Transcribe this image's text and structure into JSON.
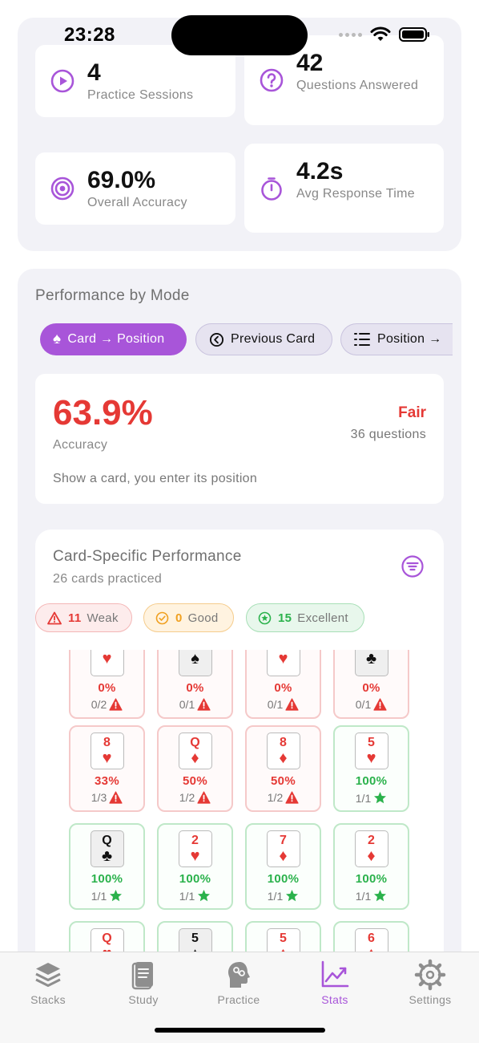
{
  "status_bar": {
    "time": "23:28"
  },
  "stats": [
    {
      "value": "4",
      "label": "Practice Sessions",
      "icon": "play-circle-icon"
    },
    {
      "value": "42",
      "label": "Questions Answered",
      "icon": "question-circle-icon"
    },
    {
      "value": "69.0%",
      "label": "Overall Accuracy",
      "icon": "target-icon"
    },
    {
      "value": "4.2s",
      "label": "Avg Response Time",
      "icon": "stopwatch-icon"
    }
  ],
  "performance": {
    "title": "Performance by Mode",
    "modes": [
      {
        "label": "Card → Position",
        "icon": "spade-icon",
        "active": true
      },
      {
        "label": "Previous Card",
        "icon": "back-circle-icon",
        "active": false
      },
      {
        "label": "Position →",
        "icon": "list-icon",
        "active": false
      }
    ],
    "accuracy": {
      "value": "63.9%",
      "label": "Accuracy",
      "rating": "Fair",
      "questions": "36 questions",
      "description": "Show a card, you enter its position"
    }
  },
  "card_specific": {
    "title": "Card-Specific Performance",
    "subtitle": "26 cards practiced",
    "badges": {
      "weak": {
        "count": "11",
        "label": "Weak"
      },
      "good": {
        "count": "0",
        "label": "Good"
      },
      "excellent": {
        "count": "15",
        "label": "Excellent"
      }
    },
    "cards": [
      {
        "rank": "",
        "suit": "♥",
        "color": "red",
        "pct": "0%",
        "frac": "0/2",
        "status": "weak"
      },
      {
        "rank": "",
        "suit": "♠",
        "color": "black",
        "pct": "0%",
        "frac": "0/1",
        "status": "weak"
      },
      {
        "rank": "",
        "suit": "♥",
        "color": "red",
        "pct": "0%",
        "frac": "0/1",
        "status": "weak"
      },
      {
        "rank": "",
        "suit": "♣",
        "color": "black",
        "pct": "0%",
        "frac": "0/1",
        "status": "weak"
      },
      {
        "rank": "8",
        "suit": "♥",
        "color": "red",
        "pct": "33%",
        "frac": "1/3",
        "status": "weak"
      },
      {
        "rank": "Q",
        "suit": "♦",
        "color": "red",
        "pct": "50%",
        "frac": "1/2",
        "status": "weak"
      },
      {
        "rank": "8",
        "suit": "♦",
        "color": "red",
        "pct": "50%",
        "frac": "1/2",
        "status": "weak"
      },
      {
        "rank": "5",
        "suit": "♥",
        "color": "red",
        "pct": "100%",
        "frac": "1/1",
        "status": "excellent"
      },
      {
        "rank": "Q",
        "suit": "♣",
        "color": "black",
        "pct": "100%",
        "frac": "1/1",
        "status": "excellent"
      },
      {
        "rank": "2",
        "suit": "♥",
        "color": "red",
        "pct": "100%",
        "frac": "1/1",
        "status": "excellent"
      },
      {
        "rank": "7",
        "suit": "♦",
        "color": "red",
        "pct": "100%",
        "frac": "1/1",
        "status": "excellent"
      },
      {
        "rank": "2",
        "suit": "♦",
        "color": "red",
        "pct": "100%",
        "frac": "1/1",
        "status": "excellent"
      },
      {
        "rank": "Q",
        "suit": "♥",
        "color": "red",
        "pct": "",
        "frac": "",
        "status": "excellent"
      },
      {
        "rank": "5",
        "suit": "♠",
        "color": "black",
        "pct": "",
        "frac": "",
        "status": "excellent"
      },
      {
        "rank": "5",
        "suit": "♦",
        "color": "red",
        "pct": "",
        "frac": "",
        "status": "excellent"
      },
      {
        "rank": "6",
        "suit": "♦",
        "color": "red",
        "pct": "",
        "frac": "",
        "status": "excellent"
      }
    ]
  },
  "tabs": [
    {
      "label": "Stacks",
      "icon": "stacks-icon",
      "active": false
    },
    {
      "label": "Study",
      "icon": "book-icon",
      "active": false
    },
    {
      "label": "Practice",
      "icon": "brain-icon",
      "active": false
    },
    {
      "label": "Stats",
      "icon": "chart-icon",
      "active": true
    },
    {
      "label": "Settings",
      "icon": "gear-icon",
      "active": false
    }
  ],
  "colors": {
    "accent": "#a855d9",
    "weak": "#e53935",
    "good": "#f0a020",
    "excellent": "#2bb24c"
  }
}
